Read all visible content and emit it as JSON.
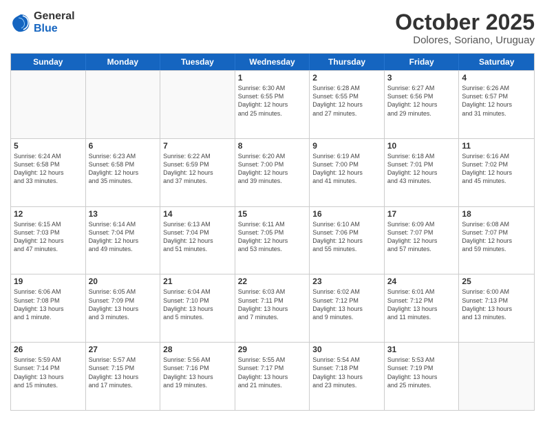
{
  "header": {
    "logo_general": "General",
    "logo_blue": "Blue",
    "month": "October 2025",
    "location": "Dolores, Soriano, Uruguay"
  },
  "days_of_week": [
    "Sunday",
    "Monday",
    "Tuesday",
    "Wednesday",
    "Thursday",
    "Friday",
    "Saturday"
  ],
  "weeks": [
    [
      {
        "day": "",
        "info": ""
      },
      {
        "day": "",
        "info": ""
      },
      {
        "day": "",
        "info": ""
      },
      {
        "day": "1",
        "info": "Sunrise: 6:30 AM\nSunset: 6:55 PM\nDaylight: 12 hours\nand 25 minutes."
      },
      {
        "day": "2",
        "info": "Sunrise: 6:28 AM\nSunset: 6:55 PM\nDaylight: 12 hours\nand 27 minutes."
      },
      {
        "day": "3",
        "info": "Sunrise: 6:27 AM\nSunset: 6:56 PM\nDaylight: 12 hours\nand 29 minutes."
      },
      {
        "day": "4",
        "info": "Sunrise: 6:26 AM\nSunset: 6:57 PM\nDaylight: 12 hours\nand 31 minutes."
      }
    ],
    [
      {
        "day": "5",
        "info": "Sunrise: 6:24 AM\nSunset: 6:58 PM\nDaylight: 12 hours\nand 33 minutes."
      },
      {
        "day": "6",
        "info": "Sunrise: 6:23 AM\nSunset: 6:58 PM\nDaylight: 12 hours\nand 35 minutes."
      },
      {
        "day": "7",
        "info": "Sunrise: 6:22 AM\nSunset: 6:59 PM\nDaylight: 12 hours\nand 37 minutes."
      },
      {
        "day": "8",
        "info": "Sunrise: 6:20 AM\nSunset: 7:00 PM\nDaylight: 12 hours\nand 39 minutes."
      },
      {
        "day": "9",
        "info": "Sunrise: 6:19 AM\nSunset: 7:00 PM\nDaylight: 12 hours\nand 41 minutes."
      },
      {
        "day": "10",
        "info": "Sunrise: 6:18 AM\nSunset: 7:01 PM\nDaylight: 12 hours\nand 43 minutes."
      },
      {
        "day": "11",
        "info": "Sunrise: 6:16 AM\nSunset: 7:02 PM\nDaylight: 12 hours\nand 45 minutes."
      }
    ],
    [
      {
        "day": "12",
        "info": "Sunrise: 6:15 AM\nSunset: 7:03 PM\nDaylight: 12 hours\nand 47 minutes."
      },
      {
        "day": "13",
        "info": "Sunrise: 6:14 AM\nSunset: 7:04 PM\nDaylight: 12 hours\nand 49 minutes."
      },
      {
        "day": "14",
        "info": "Sunrise: 6:13 AM\nSunset: 7:04 PM\nDaylight: 12 hours\nand 51 minutes."
      },
      {
        "day": "15",
        "info": "Sunrise: 6:11 AM\nSunset: 7:05 PM\nDaylight: 12 hours\nand 53 minutes."
      },
      {
        "day": "16",
        "info": "Sunrise: 6:10 AM\nSunset: 7:06 PM\nDaylight: 12 hours\nand 55 minutes."
      },
      {
        "day": "17",
        "info": "Sunrise: 6:09 AM\nSunset: 7:07 PM\nDaylight: 12 hours\nand 57 minutes."
      },
      {
        "day": "18",
        "info": "Sunrise: 6:08 AM\nSunset: 7:07 PM\nDaylight: 12 hours\nand 59 minutes."
      }
    ],
    [
      {
        "day": "19",
        "info": "Sunrise: 6:06 AM\nSunset: 7:08 PM\nDaylight: 13 hours\nand 1 minute."
      },
      {
        "day": "20",
        "info": "Sunrise: 6:05 AM\nSunset: 7:09 PM\nDaylight: 13 hours\nand 3 minutes."
      },
      {
        "day": "21",
        "info": "Sunrise: 6:04 AM\nSunset: 7:10 PM\nDaylight: 13 hours\nand 5 minutes."
      },
      {
        "day": "22",
        "info": "Sunrise: 6:03 AM\nSunset: 7:11 PM\nDaylight: 13 hours\nand 7 minutes."
      },
      {
        "day": "23",
        "info": "Sunrise: 6:02 AM\nSunset: 7:12 PM\nDaylight: 13 hours\nand 9 minutes."
      },
      {
        "day": "24",
        "info": "Sunrise: 6:01 AM\nSunset: 7:12 PM\nDaylight: 13 hours\nand 11 minutes."
      },
      {
        "day": "25",
        "info": "Sunrise: 6:00 AM\nSunset: 7:13 PM\nDaylight: 13 hours\nand 13 minutes."
      }
    ],
    [
      {
        "day": "26",
        "info": "Sunrise: 5:59 AM\nSunset: 7:14 PM\nDaylight: 13 hours\nand 15 minutes."
      },
      {
        "day": "27",
        "info": "Sunrise: 5:57 AM\nSunset: 7:15 PM\nDaylight: 13 hours\nand 17 minutes."
      },
      {
        "day": "28",
        "info": "Sunrise: 5:56 AM\nSunset: 7:16 PM\nDaylight: 13 hours\nand 19 minutes."
      },
      {
        "day": "29",
        "info": "Sunrise: 5:55 AM\nSunset: 7:17 PM\nDaylight: 13 hours\nand 21 minutes."
      },
      {
        "day": "30",
        "info": "Sunrise: 5:54 AM\nSunset: 7:18 PM\nDaylight: 13 hours\nand 23 minutes."
      },
      {
        "day": "31",
        "info": "Sunrise: 5:53 AM\nSunset: 7:19 PM\nDaylight: 13 hours\nand 25 minutes."
      },
      {
        "day": "",
        "info": ""
      }
    ]
  ]
}
